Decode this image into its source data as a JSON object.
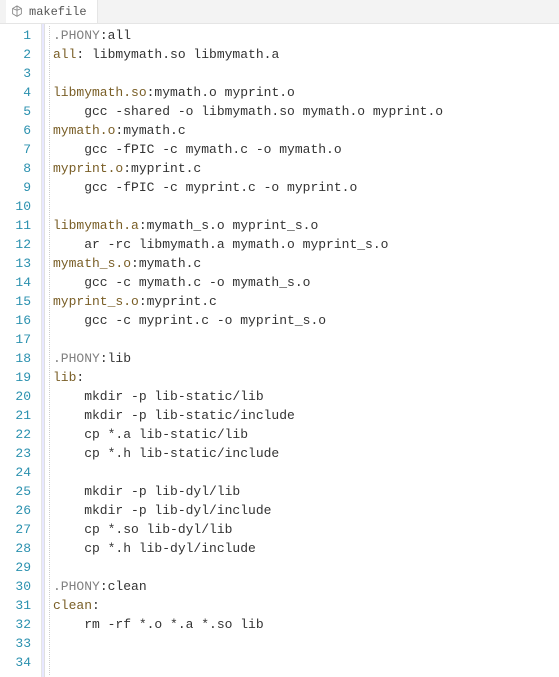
{
  "tab": {
    "filename": "makefile"
  },
  "code": {
    "lines": [
      {
        "n": 1,
        "segments": [
          {
            "cls": "tok-directive",
            "t": ".PHONY"
          },
          {
            "cls": "tok-default",
            "t": ":all"
          }
        ]
      },
      {
        "n": 2,
        "segments": [
          {
            "cls": "tok-target",
            "t": "all"
          },
          {
            "cls": "tok-default",
            "t": ": libmymath.so libmymath.a"
          }
        ]
      },
      {
        "n": 3,
        "segments": []
      },
      {
        "n": 4,
        "segments": [
          {
            "cls": "tok-target",
            "t": "libmymath.so"
          },
          {
            "cls": "tok-default",
            "t": ":mymath.o myprint.o"
          }
        ]
      },
      {
        "n": 5,
        "segments": [
          {
            "cls": "tok-default",
            "t": "    gcc -shared -o libmymath.so mymath.o myprint.o"
          }
        ]
      },
      {
        "n": 6,
        "segments": [
          {
            "cls": "tok-target",
            "t": "mymath.o"
          },
          {
            "cls": "tok-default",
            "t": ":mymath.c"
          }
        ]
      },
      {
        "n": 7,
        "segments": [
          {
            "cls": "tok-default",
            "t": "    gcc -fPIC -c mymath.c -o mymath.o"
          }
        ]
      },
      {
        "n": 8,
        "segments": [
          {
            "cls": "tok-target",
            "t": "myprint.o"
          },
          {
            "cls": "tok-default",
            "t": ":myprint.c"
          }
        ]
      },
      {
        "n": 9,
        "segments": [
          {
            "cls": "tok-default",
            "t": "    gcc -fPIC -c myprint.c -o myprint.o"
          }
        ]
      },
      {
        "n": 10,
        "segments": []
      },
      {
        "n": 11,
        "segments": [
          {
            "cls": "tok-target",
            "t": "libmymath.a"
          },
          {
            "cls": "tok-default",
            "t": ":mymath_s.o myprint_s.o"
          }
        ]
      },
      {
        "n": 12,
        "segments": [
          {
            "cls": "tok-default",
            "t": "    ar -rc libmymath.a mymath.o myprint_s.o"
          }
        ]
      },
      {
        "n": 13,
        "segments": [
          {
            "cls": "tok-target",
            "t": "mymath_s.o"
          },
          {
            "cls": "tok-default",
            "t": ":mymath.c"
          }
        ]
      },
      {
        "n": 14,
        "segments": [
          {
            "cls": "tok-default",
            "t": "    gcc -c mymath.c -o mymath_s.o"
          }
        ]
      },
      {
        "n": 15,
        "segments": [
          {
            "cls": "tok-target",
            "t": "myprint_s.o"
          },
          {
            "cls": "tok-default",
            "t": ":myprint.c"
          }
        ]
      },
      {
        "n": 16,
        "segments": [
          {
            "cls": "tok-default",
            "t": "    gcc -c myprint.c -o myprint_s.o"
          }
        ]
      },
      {
        "n": 17,
        "segments": []
      },
      {
        "n": 18,
        "segments": [
          {
            "cls": "tok-directive",
            "t": ".PHONY"
          },
          {
            "cls": "tok-default",
            "t": ":lib"
          }
        ]
      },
      {
        "n": 19,
        "segments": [
          {
            "cls": "tok-target",
            "t": "lib"
          },
          {
            "cls": "tok-default",
            "t": ":"
          }
        ]
      },
      {
        "n": 20,
        "segments": [
          {
            "cls": "tok-default",
            "t": "    mkdir -p lib-static/lib"
          }
        ]
      },
      {
        "n": 21,
        "segments": [
          {
            "cls": "tok-default",
            "t": "    mkdir -p lib-static/include"
          }
        ]
      },
      {
        "n": 22,
        "segments": [
          {
            "cls": "tok-default",
            "t": "    cp *.a lib-static/lib"
          }
        ]
      },
      {
        "n": 23,
        "segments": [
          {
            "cls": "tok-default",
            "t": "    cp *.h lib-static/include"
          }
        ]
      },
      {
        "n": 24,
        "segments": []
      },
      {
        "n": 25,
        "segments": [
          {
            "cls": "tok-default",
            "t": "    mkdir -p lib-dyl/lib"
          }
        ]
      },
      {
        "n": 26,
        "segments": [
          {
            "cls": "tok-default",
            "t": "    mkdir -p lib-dyl/include"
          }
        ]
      },
      {
        "n": 27,
        "segments": [
          {
            "cls": "tok-default",
            "t": "    cp *.so lib-dyl/lib"
          }
        ]
      },
      {
        "n": 28,
        "segments": [
          {
            "cls": "tok-default",
            "t": "    cp *.h lib-dyl/include"
          }
        ]
      },
      {
        "n": 29,
        "segments": []
      },
      {
        "n": 30,
        "segments": [
          {
            "cls": "tok-directive",
            "t": ".PHONY"
          },
          {
            "cls": "tok-default",
            "t": ":clean"
          }
        ]
      },
      {
        "n": 31,
        "segments": [
          {
            "cls": "tok-target",
            "t": "clean"
          },
          {
            "cls": "tok-default",
            "t": ":"
          }
        ]
      },
      {
        "n": 32,
        "segments": [
          {
            "cls": "tok-default",
            "t": "    rm -rf *.o *.a *.so lib"
          }
        ]
      },
      {
        "n": 33,
        "segments": []
      },
      {
        "n": 34,
        "segments": []
      }
    ]
  }
}
